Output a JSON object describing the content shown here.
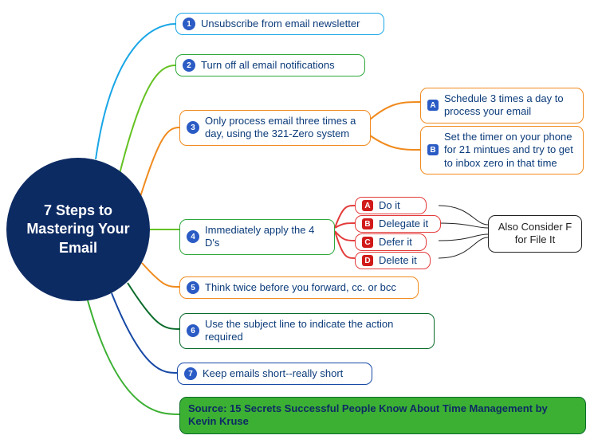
{
  "central": {
    "title": "7 Steps to Mastering Your Email"
  },
  "steps": [
    {
      "num": "1",
      "label": "Unsubscribe from email newsletter",
      "color": "#19a6e6"
    },
    {
      "num": "2",
      "label": "Turn off all email notifications",
      "color": "#2ea83a"
    },
    {
      "num": "3",
      "label": "Only process email three times a day, using the 321-Zero system",
      "color": "#f08a1d"
    },
    {
      "num": "4",
      "label": "Immediately apply the 4 D's",
      "color": "#2ea83a"
    },
    {
      "num": "5",
      "label": "Think twice before you forward, cc. or bcc",
      "color": "#f08a1d"
    },
    {
      "num": "6",
      "label": "Use the subject line to indicate the action required",
      "color": "#0a6b2a"
    },
    {
      "num": "7",
      "label": "Keep emails short--really short",
      "color": "#1648a5"
    }
  ],
  "step3_children": [
    {
      "letter": "A",
      "label": "Schedule 3 times a day to process your email"
    },
    {
      "letter": "B",
      "label": "Set the timer on your phone for 21 mintues and try to get to inbox zero in that time"
    }
  ],
  "step4_children": [
    {
      "letter": "A",
      "label": "Do it"
    },
    {
      "letter": "B",
      "label": "Delegate it"
    },
    {
      "letter": "C",
      "label": "Defer it"
    },
    {
      "letter": "D",
      "label": "Delete it"
    }
  ],
  "step4_note": "Also Consider F for File It",
  "source": {
    "label": "Source: 15 Secrets Successful People Know About Time Management by Kevin Kruse",
    "bg": "#3cb033"
  },
  "badge_colors": {
    "step": "#2b5bc4",
    "sub3": "#2b5bc4",
    "sub4": "#d11a1a"
  },
  "connector_colors": {
    "s1": "#19a6e6",
    "s2": "#64c222",
    "s3": "#f08a1d",
    "s4": "#64c222",
    "s5": "#f08a1d",
    "s6": "#0a6b2a",
    "s7": "#1648a5",
    "src": "#3cb033",
    "sub3": "#f08a1d",
    "sub4": "#e33a3a",
    "note": "#222"
  },
  "chart_data": {
    "type": "mindmap",
    "root": "7 Steps to Mastering Your Email",
    "branches": [
      {
        "id": 1,
        "text": "Unsubscribe from email newsletter"
      },
      {
        "id": 2,
        "text": "Turn off all email notifications"
      },
      {
        "id": 3,
        "text": "Only process email three times a day, using the 321-Zero system",
        "children": [
          {
            "id": "A",
            "text": "Schedule 3 times a day to process your email"
          },
          {
            "id": "B",
            "text": "Set the timer on your phone for 21 mintues and try to get to inbox zero in that time"
          }
        ]
      },
      {
        "id": 4,
        "text": "Immediately apply the 4 D's",
        "children": [
          {
            "id": "A",
            "text": "Do it"
          },
          {
            "id": "B",
            "text": "Delegate it"
          },
          {
            "id": "C",
            "text": "Defer it"
          },
          {
            "id": "D",
            "text": "Delete it"
          }
        ],
        "note": "Also Consider F for File It"
      },
      {
        "id": 5,
        "text": "Think twice before you forward, cc. or bcc"
      },
      {
        "id": 6,
        "text": "Use the subject line to indicate the action required"
      },
      {
        "id": 7,
        "text": "Keep emails short--really short"
      },
      {
        "id": "source",
        "text": "Source: 15 Secrets Successful People Know About Time Management by Kevin Kruse"
      }
    ]
  }
}
